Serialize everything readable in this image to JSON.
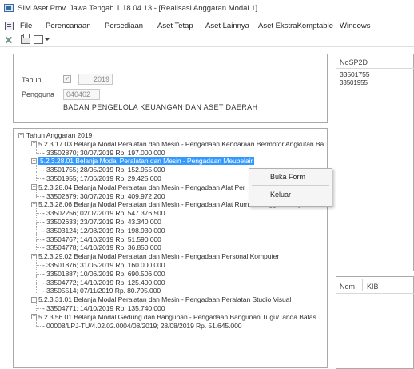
{
  "window": {
    "title": "SIM Aset Prov. Jawa Tengah 1.18.04.13 - [Realisasi Anggaran Modal 1]"
  },
  "menu": [
    "File",
    "Perencanaan",
    "Persediaan",
    "Aset Tetap",
    "Aset Lainnya",
    "Aset EkstraKomptable",
    "Windows"
  ],
  "form": {
    "tahun_label": "Tahun",
    "tahun_checked": "✓",
    "tahun_value": "2019",
    "pengguna_label": "Pengguna",
    "pengguna_code": "040402",
    "pengguna_name": "BADAN PENGELOLA KEUANGAN DAN ASET DAERAH"
  },
  "tree": {
    "root": "Tahun Anggaran 2019",
    "nodes": [
      {
        "text": "5.2.3.17.03 Belanja Modal Peralatan dan Mesin - Pengadaan Kendaraan Bermotor Angkutan Ba",
        "children": [
          "33502870; 30/07/2019 Rp. 197.000.000"
        ]
      },
      {
        "text": "5.2.3.28.01 Belanja Modal Peralatan dan Mesin - Pengadaan Meubelair",
        "children": [
          "33501755; 28/05/2019 Rp. 152.955.000",
          "33501955; 17/06/2019 Rp. 29.425.000"
        ]
      },
      {
        "text": "5.2.3.28.04 Belanja Modal Peralatan dan Mesin - Pengadaan Alat Per",
        "children": [
          "33502879; 30/07/2019 Rp. 409.972.200"
        ]
      },
      {
        "text": "5.2.3.28.06 Belanja Modal Peralatan dan Mesin - Pengadaan Alat Rumah Tangga Lainnya (Hor",
        "children": [
          "33502256; 02/07/2019 Rp. 547.376.500",
          "33502633; 23/07/2019 Rp. 43.340.000",
          "33503124; 12/08/2019 Rp. 198.930.000",
          "33504767; 14/10/2019 Rp. 51.590.000",
          "33504778; 14/10/2019 Rp. 36.850.000"
        ]
      },
      {
        "text": "5.2.3.29.02 Belanja Modal Peralatan dan Mesin - Pengadaan Personal Komputer",
        "children": [
          "33501876; 31/05/2019 Rp. 160.000.000",
          "33501887; 10/06/2019 Rp. 690.506.000",
          "33504772; 14/10/2019 Rp. 125.400.000",
          "33505514; 07/11/2019 Rp. 80.795.000"
        ]
      },
      {
        "text": "5.2.3.31.01 Belanja Modal Peralatan dan Mesin - Pengadaan Peralatan Studio Visual",
        "children": [
          "33504771; 14/10/2019 Rp. 135.740.000"
        ]
      },
      {
        "text": "5.2.3.56.01 Belanja Modal Gedung dan Bangunan - Pengadaan Bangunan Tugu/Tanda Batas",
        "children": [
          "00008/LPJ-TU/4.02.02.0004/08/2019; 28/08/2019 Rp. 51.645.000"
        ]
      }
    ]
  },
  "context_menu": [
    "Buka Form",
    "Keluar"
  ],
  "right_top": {
    "header": "NoSP2D",
    "rows": [
      "33501755",
      "33501955"
    ]
  },
  "right_bottom": {
    "headers": [
      "Nom",
      "KIB"
    ]
  }
}
